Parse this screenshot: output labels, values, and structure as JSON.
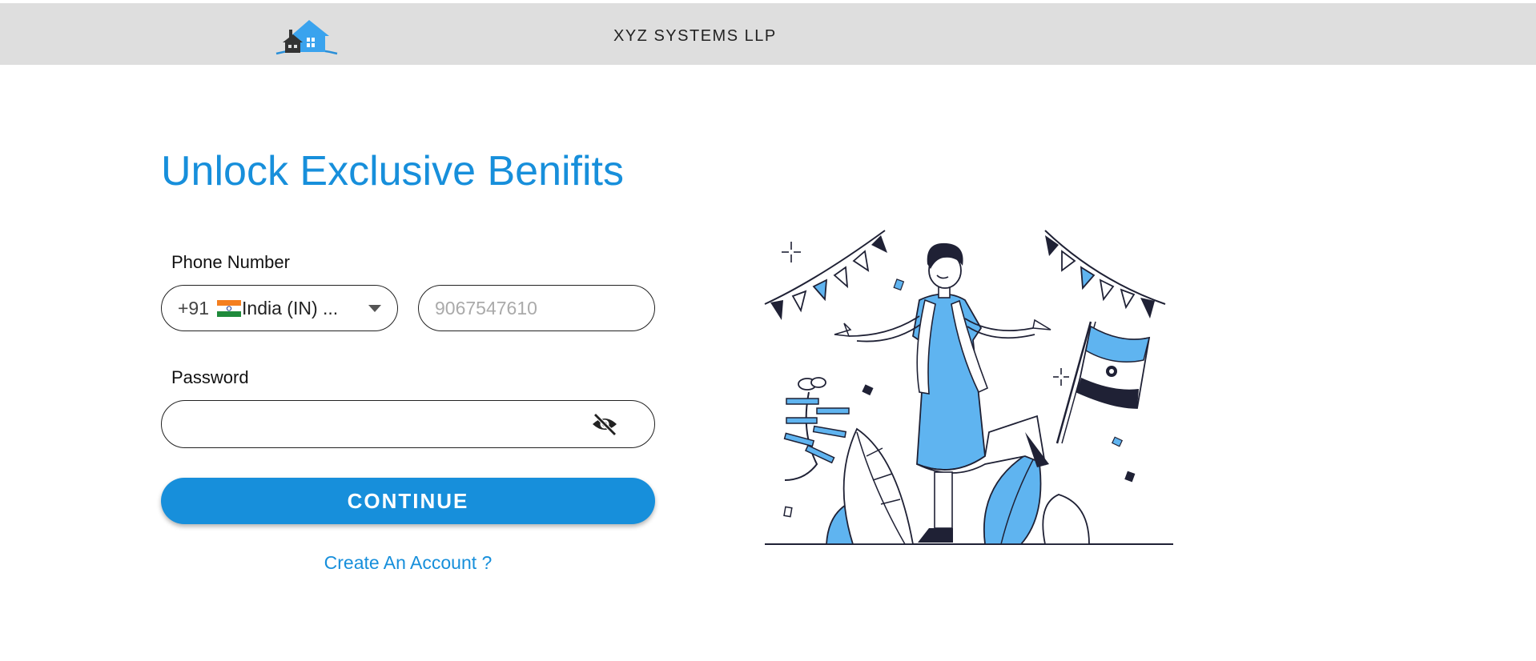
{
  "header": {
    "company_name": "XYZ SYSTEMS LLP",
    "logo_icon": "house-logo-icon"
  },
  "main": {
    "headline": "Unlock Exclusive Benifits",
    "phone": {
      "label": "Phone Number",
      "country_code": "+91",
      "country_name": "India (IN) ...",
      "country_flag_icon": "india-flag-icon",
      "placeholder": "9067547610",
      "value": ""
    },
    "password": {
      "label": "Password",
      "value": "",
      "toggle_icon": "eye-slash-icon"
    },
    "continue_label": "CONTINUE",
    "create_account_label": "Create An Account ?"
  },
  "colors": {
    "accent": "#178fdb",
    "header_bg": "#dedede",
    "illustration_blue": "#5fb4f0",
    "illustration_dark": "#1f2135"
  }
}
